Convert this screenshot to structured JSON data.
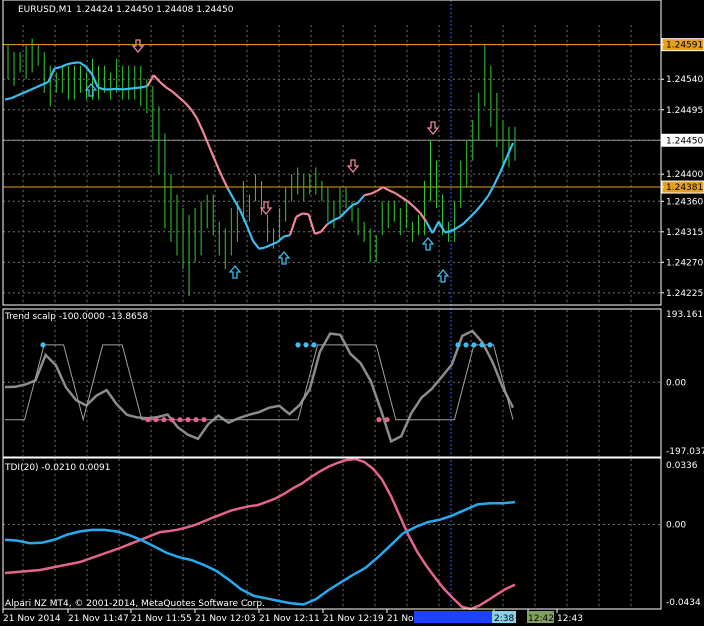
{
  "header": {
    "symbol": "EURUSD,M1",
    "quote": "1.24424 1.24450 1.24408 1.24450"
  },
  "colors": {
    "background": "#000000",
    "frame": "#ffffff",
    "grid": "#707070",
    "candle": "#32cd32",
    "fast_line_down": "#f0879b",
    "fast_line_up": "#3cbef0",
    "level_line": "#e6a020",
    "trend_line": "#8c8c8c",
    "tdi_pink": "#e6648c",
    "tdi_blue": "#28aaf0",
    "arrow_up": "#3cbef0",
    "arrow_down": "#f0879b"
  },
  "price_panel": {
    "level_high_label": "1.24591",
    "level_low_label": "1.24381",
    "current_label": "1.24450"
  },
  "indicators": {
    "trend_scalp_title": "Trend scalp -100.0000 -13.8658",
    "tdi_title": "TDI(20) -0.0210 0.0091"
  },
  "time_labels": [
    "21 Nov 2014",
    "21 Nov 11:47",
    "21 Nov 11:55",
    "21 Nov 12:03",
    "21 Nov 12:11",
    "21 Nov 12:19",
    "21 No",
    "2:38",
    "12:42",
    "12:43"
  ],
  "time_highlight": {
    "blue_box": "",
    "cyan_box": "2:38",
    "green_box": "12:42"
  },
  "copyright": "Alpari NZ MT4, © 2001-2014, MetaQuotes Software Corp.",
  "chart_data": [
    {
      "type": "line",
      "title": "EURUSD,M1",
      "y_ticks": [
        "1.24591",
        "1.24540",
        "1.24495",
        "1.24450",
        "1.24400",
        "1.24381",
        "1.24360",
        "1.24315",
        "1.24270",
        "1.24225"
      ],
      "ylim": [
        1.2421,
        1.2462
      ],
      "candles_high_low": [
        [
          1.2454,
          1.2459
        ],
        [
          1.2453,
          1.2458
        ],
        [
          1.2455,
          1.2458
        ],
        [
          1.2454,
          1.2459
        ],
        [
          1.2455,
          1.246
        ],
        [
          1.2456,
          1.2459
        ],
        [
          1.2452,
          1.2458
        ],
        [
          1.245,
          1.2456
        ],
        [
          1.2452,
          1.2455
        ],
        [
          1.2452,
          1.2456
        ],
        [
          1.2451,
          1.2456
        ],
        [
          1.2451,
          1.2456
        ],
        [
          1.2452,
          1.2456
        ],
        [
          1.2451,
          1.2455
        ],
        [
          1.2451,
          1.2457
        ],
        [
          1.2451,
          1.2456
        ],
        [
          1.2452,
          1.2456
        ],
        [
          1.2451,
          1.2455
        ],
        [
          1.2452,
          1.2457
        ],
        [
          1.2451,
          1.2456
        ],
        [
          1.2451,
          1.2456
        ],
        [
          1.2451,
          1.2456
        ],
        [
          1.245,
          1.2456
        ],
        [
          1.2449,
          1.2454
        ],
        [
          1.2445,
          1.2453
        ],
        [
          1.244,
          1.245
        ],
        [
          1.2432,
          1.2446
        ],
        [
          1.243,
          1.244
        ],
        [
          1.2428,
          1.2437
        ],
        [
          1.2426,
          1.2435
        ],
        [
          1.2422,
          1.2434
        ],
        [
          1.2427,
          1.2435
        ],
        [
          1.2428,
          1.2436
        ],
        [
          1.2432,
          1.2437
        ],
        [
          1.2431,
          1.2437
        ],
        [
          1.2428,
          1.2433
        ],
        [
          1.2426,
          1.2432
        ],
        [
          1.2428,
          1.2435
        ],
        [
          1.243,
          1.2436
        ],
        [
          1.2433,
          1.2439
        ],
        [
          1.2433,
          1.2437
        ],
        [
          1.2436,
          1.244
        ],
        [
          1.2434,
          1.2439
        ],
        [
          1.243,
          1.2434
        ],
        [
          1.2429,
          1.2432
        ],
        [
          1.243,
          1.2435
        ],
        [
          1.2433,
          1.2438
        ],
        [
          1.2436,
          1.244
        ],
        [
          1.2437,
          1.2441
        ],
        [
          1.2436,
          1.244
        ],
        [
          1.2437,
          1.244
        ],
        [
          1.2437,
          1.2441
        ],
        [
          1.2436,
          1.2439
        ],
        [
          1.2433,
          1.2438
        ],
        [
          1.2432,
          1.2436
        ],
        [
          1.2434,
          1.2438
        ],
        [
          1.2435,
          1.2438
        ],
        [
          1.2433,
          1.2436
        ],
        [
          1.2431,
          1.2435
        ],
        [
          1.243,
          1.2433
        ],
        [
          1.2427,
          1.2432
        ],
        [
          1.2427,
          1.2431
        ],
        [
          1.2431,
          1.2436
        ],
        [
          1.2432,
          1.2436
        ],
        [
          1.2433,
          1.2436
        ],
        [
          1.2431,
          1.2435
        ],
        [
          1.2432,
          1.2436
        ],
        [
          1.243,
          1.2433
        ],
        [
          1.2431,
          1.2434
        ],
        [
          1.2431,
          1.2439
        ],
        [
          1.2436,
          1.2445
        ],
        [
          1.2435,
          1.2442
        ],
        [
          1.2431,
          1.2437
        ],
        [
          1.243,
          1.2433
        ],
        [
          1.243,
          1.2436
        ],
        [
          1.2435,
          1.2442
        ],
        [
          1.2438,
          1.2445
        ],
        [
          1.2442,
          1.2448
        ],
        [
          1.2445,
          1.2452
        ],
        [
          1.245,
          1.2459
        ],
        [
          1.2447,
          1.2456
        ],
        [
          1.2444,
          1.2452
        ],
        [
          1.2441,
          1.2448
        ],
        [
          1.2441,
          1.2447
        ],
        [
          1.2442,
          1.2447
        ]
      ],
      "series": [
        {
          "values": [
            1.2451,
            1.24512,
            1.24516,
            1.2452,
            1.24524,
            1.24528,
            1.24532,
            1.24536,
            1.24556,
            1.24558,
            1.24562,
            1.24564,
            1.24565,
            1.24559,
            1.24548,
            1.24528,
            1.24525,
            1.24525,
            1.24526,
            1.24525,
            1.24526,
            1.24527,
            1.24528,
            1.2453,
            1.24546,
            1.24536,
            1.24528,
            1.24522,
            1.24514,
            1.24506,
            1.24496,
            1.24482,
            1.24462,
            1.2444,
            1.24418,
            1.24397,
            1.24378,
            1.24362,
            1.24346,
            1.24325,
            1.24302,
            1.2429,
            1.24292,
            1.24296,
            1.243,
            1.24308,
            1.2431,
            1.24337,
            1.24342,
            1.24341,
            1.24312,
            1.24315,
            1.24326,
            1.24332,
            1.24336,
            1.24345,
            1.24354,
            1.24358,
            1.24369,
            1.24371,
            1.24375,
            1.24381,
            1.24376,
            1.24372,
            1.24366,
            1.2436,
            1.24352,
            1.24343,
            1.2433,
            1.24313,
            1.2433,
            1.24314,
            1.24316,
            1.24321,
            1.24327,
            1.24336,
            1.24345,
            1.24356,
            1.24368,
            1.24385,
            1.24404,
            1.24425,
            1.24446
          ]
        }
      ]
    },
    {
      "type": "line",
      "title": "Trend scalp -100.0000 -13.8658",
      "y_ticks": [
        "193.1611",
        "0.00",
        "-197.0378"
      ],
      "ylim": [
        -197.0378,
        193.1611
      ],
      "series": [
        {
          "values": [
            -13,
            -12,
            -6,
            5,
            73,
            46,
            -14,
            -48,
            -62,
            -36,
            -21,
            -59,
            -87,
            -94,
            -96,
            -93,
            -86,
            -120,
            -140,
            -151,
            -112,
            -89,
            -108,
            -96,
            -87,
            -80,
            -68,
            -63,
            -85,
            -61,
            -18,
            82,
            130,
            127,
            76,
            51,
            3,
            -74,
            -158,
            -144,
            -82,
            -41,
            -18,
            15,
            48,
            124,
            137,
            106,
            53,
            -14,
            -68
          ]
        },
        {
          "values": [
            -100,
            -100,
            100,
            100,
            -100,
            100,
            100,
            -100,
            -100,
            -100,
            -100,
            -100,
            -100,
            -100,
            -100,
            -100,
            100,
            100,
            100,
            100,
            -100,
            -100,
            -100,
            -100,
            100,
            100,
            -100
          ]
        }
      ]
    },
    {
      "type": "line",
      "title": "TDI(20) -0.0210 0.0091",
      "y_ticks": [
        "0.0336",
        "0.00",
        "-0.0434"
      ],
      "ylim": [
        -0.0434,
        0.0336
      ],
      "series": [
        {
          "values": [
            -0.0039,
            -0.0034,
            -0.0027,
            -0.0015,
            -0.0002,
            0.0017,
            0.0036,
            0.0053,
            0.0071,
            0.0083,
            0.0093,
            0.0099,
            0.0116,
            0.0133,
            0.0158,
            0.0186,
            0.0211,
            0.0243,
            0.0272,
            0.0297,
            0.0316,
            0.0331,
            0.0336,
            0.0321,
            0.0286,
            0.0232,
            0.0147,
            0.0046,
            -0.0056,
            -0.0142,
            -0.0212,
            -0.0273,
            -0.0331,
            -0.0378,
            -0.0422,
            -0.0434,
            -0.0416,
            -0.0388,
            -0.0358,
            -0.033,
            -0.0309
          ]
        },
        {
          "values": [
            -0.0079,
            -0.0083,
            -0.0096,
            -0.0093,
            -0.0078,
            -0.0052,
            -0.0036,
            -0.0028,
            -0.0028,
            -0.0036,
            -0.0055,
            -0.0081,
            -0.0113,
            -0.0146,
            -0.0168,
            -0.0183,
            -0.0208,
            -0.0239,
            -0.0284,
            -0.0334,
            -0.0367,
            -0.0379,
            -0.0393,
            -0.0404,
            -0.0411,
            -0.0383,
            -0.0337,
            -0.0297,
            -0.0258,
            -0.0222,
            -0.0167,
            -0.0107,
            -0.0046,
            -0.0013,
            0.0012,
            0.0025,
            0.0047,
            0.0075,
            0.0103,
            0.0109,
            0.0109,
            0.0115
          ]
        }
      ]
    }
  ]
}
